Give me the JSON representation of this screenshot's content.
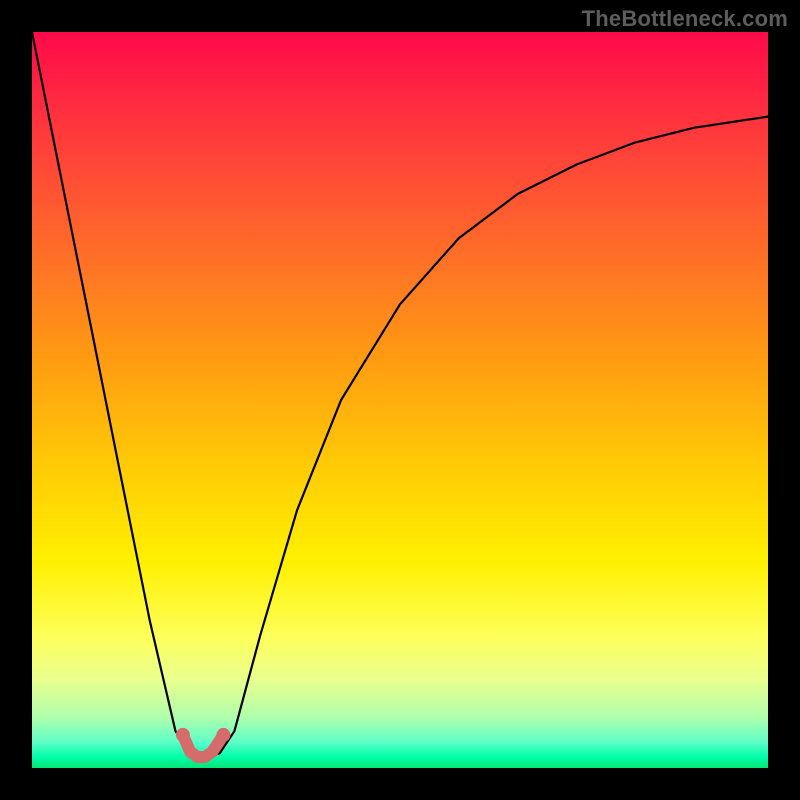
{
  "watermark": {
    "text": "TheBottleneck.com"
  },
  "colors": {
    "frame": "#000000",
    "curve": "#000000",
    "highlight_stroke": "#d66b6c",
    "gradient_stops": [
      "#ff0a4a",
      "#ff1e44",
      "#ff3a3c",
      "#ff5a30",
      "#ff7a22",
      "#ff9a12",
      "#ffc806",
      "#fff000",
      "#feff59",
      "#e9ff8e",
      "#b1ffac",
      "#5effc8",
      "#00ffaa",
      "#00e676"
    ]
  },
  "chart_data": {
    "type": "line",
    "title": "",
    "xlabel": "",
    "ylabel": "",
    "xlim": [
      0,
      1
    ],
    "ylim": [
      0,
      1
    ],
    "note": "Axes are unitless (no tick labels shown in image). x is the horizontal position across the plot area; y is the vertical value where 0 is the bottom (green) and 1 is the top (red). Curve values estimated from gridless image.",
    "series": [
      {
        "name": "bottleneck-curve",
        "x": [
          0.0,
          0.04,
          0.08,
          0.12,
          0.16,
          0.195,
          0.215,
          0.235,
          0.255,
          0.275,
          0.31,
          0.36,
          0.42,
          0.5,
          0.58,
          0.66,
          0.74,
          0.82,
          0.9,
          1.0
        ],
        "y": [
          1.0,
          0.8,
          0.6,
          0.4,
          0.2,
          0.05,
          0.02,
          0.015,
          0.02,
          0.05,
          0.18,
          0.35,
          0.5,
          0.63,
          0.72,
          0.78,
          0.82,
          0.85,
          0.87,
          0.885
        ]
      }
    ],
    "highlight": {
      "name": "minimum-region",
      "x": [
        0.205,
        0.215,
        0.225,
        0.235,
        0.245,
        0.26
      ],
      "y": [
        0.045,
        0.022,
        0.015,
        0.015,
        0.022,
        0.045
      ]
    }
  }
}
